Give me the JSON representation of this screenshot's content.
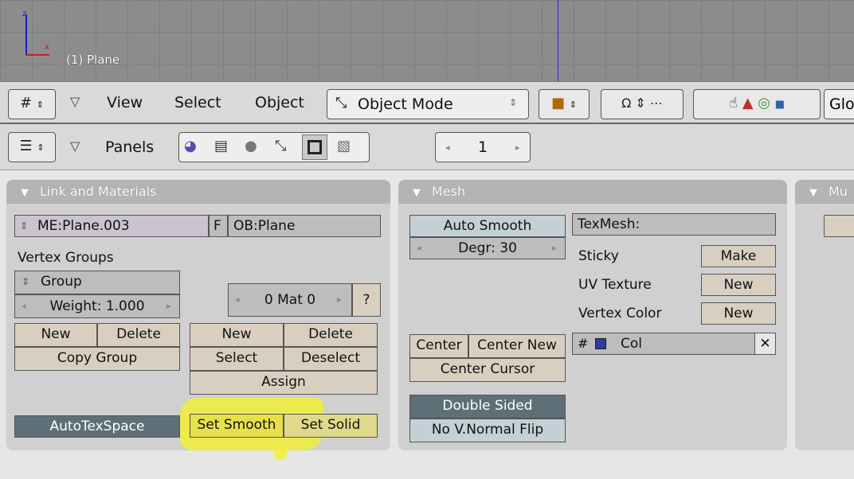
{
  "viewport": {
    "object_label": "(1) Plane",
    "axis_z": "z",
    "axis_x": "x"
  },
  "header": {
    "view": "View",
    "select": "Select",
    "object": "Object",
    "mode": "Object Mode",
    "global_partial": "Glo"
  },
  "buttons_header": {
    "panels": "Panels",
    "frame": "1"
  },
  "link_materials": {
    "title": "Link and Materials",
    "mesh_name": "ME:Plane.003",
    "fake_user": "F",
    "object_name": "OB:Plane",
    "vertex_groups": "Vertex Groups",
    "group_name": "Group",
    "weight": "Weight: 1.000",
    "vg_new": "New",
    "vg_delete": "Delete",
    "copy_group": "Copy Group",
    "mat_index": "0 Mat 0",
    "mat_help": "?",
    "mat_new": "New",
    "mat_delete": "Delete",
    "mat_select": "Select",
    "mat_deselect": "Deselect",
    "assign": "Assign",
    "autotexspace": "AutoTexSpace",
    "set_smooth": "Set Smooth",
    "set_solid": "Set Solid"
  },
  "mesh": {
    "title": "Mesh",
    "auto_smooth": "Auto Smooth",
    "degr": "Degr: 30",
    "texmesh": "TexMesh:",
    "sticky": "Sticky",
    "sticky_btn": "Make",
    "uv_texture": "UV Texture",
    "uv_btn": "New",
    "vertex_color": "Vertex Color",
    "vc_btn": "New",
    "col_name": "Col",
    "col_delete": "✕",
    "center": "Center",
    "center_new": "Center New",
    "center_cursor": "Center Cursor",
    "double_sided": "Double Sided",
    "no_normal_flip": "No V.Normal Flip"
  },
  "partial_panel": {
    "title": "Mu"
  }
}
